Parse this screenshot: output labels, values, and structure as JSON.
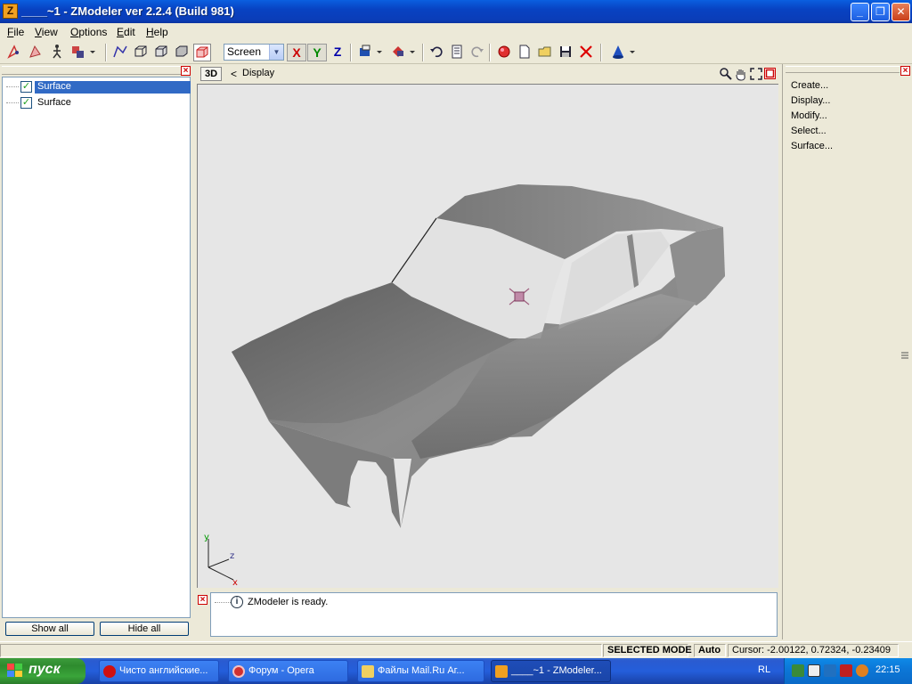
{
  "window": {
    "title": "____~1 - ZModeler ver 2.2.4 (Build 981)",
    "app_icon_letter": "Z",
    "minimize_glyph": "_",
    "maximize_glyph": "❐",
    "close_glyph": "✕"
  },
  "menu": {
    "items": [
      "File",
      "View",
      "Options",
      "Edit",
      "Help"
    ]
  },
  "toolbar": {
    "coord_mode": "Screen",
    "axes": [
      "X",
      "Y",
      "Z"
    ],
    "icons": [
      "select-vertex-icon",
      "select-face-icon",
      "walk-icon",
      "objects-icon",
      "poly-line-icon",
      "box-icon",
      "box-frame-icon",
      "box-solid-icon",
      "box-shaded-icon",
      "box-highlight-icon",
      "texture-icon",
      "material-icon",
      "undo-icon",
      "page-icon",
      "redo-icon",
      "render-icon",
      "new-file-icon",
      "open-icon",
      "save-icon",
      "delete-icon",
      "cone-icon"
    ]
  },
  "left_panel": {
    "tree": [
      {
        "label": "Surface",
        "checked": true,
        "selected": true
      },
      {
        "label": "Surface",
        "checked": true,
        "selected": false
      }
    ],
    "show_all": "Show all",
    "hide_all": "Hide all"
  },
  "viewport": {
    "view_label": "3D",
    "nav_prefix": "<",
    "title": "Display",
    "axes": {
      "y": "y",
      "z": "z",
      "x": "x"
    },
    "colors": {
      "background": "#e6e6e6",
      "model": "#8c8c8c"
    }
  },
  "right_panel": {
    "items": [
      "Create...",
      "Display...",
      "Modify...",
      "Select...",
      "Surface..."
    ]
  },
  "log": {
    "message": "ZModeler is ready."
  },
  "status": {
    "mode": "SELECTED MODE",
    "auto": "Auto",
    "cursor": "Cursor: -2.00122, 0.72324, -0.23409"
  },
  "taskbar": {
    "start": "пуск",
    "tasks": [
      {
        "label": "Чисто английские...",
        "active": false
      },
      {
        "label": "Форум - Opera",
        "active": false
      },
      {
        "label": "Файлы Mail.Ru Аг...",
        "active": false
      },
      {
        "label": "____~1 - ZModeler...",
        "active": true
      }
    ],
    "lang": "RL",
    "clock": "22:15"
  }
}
